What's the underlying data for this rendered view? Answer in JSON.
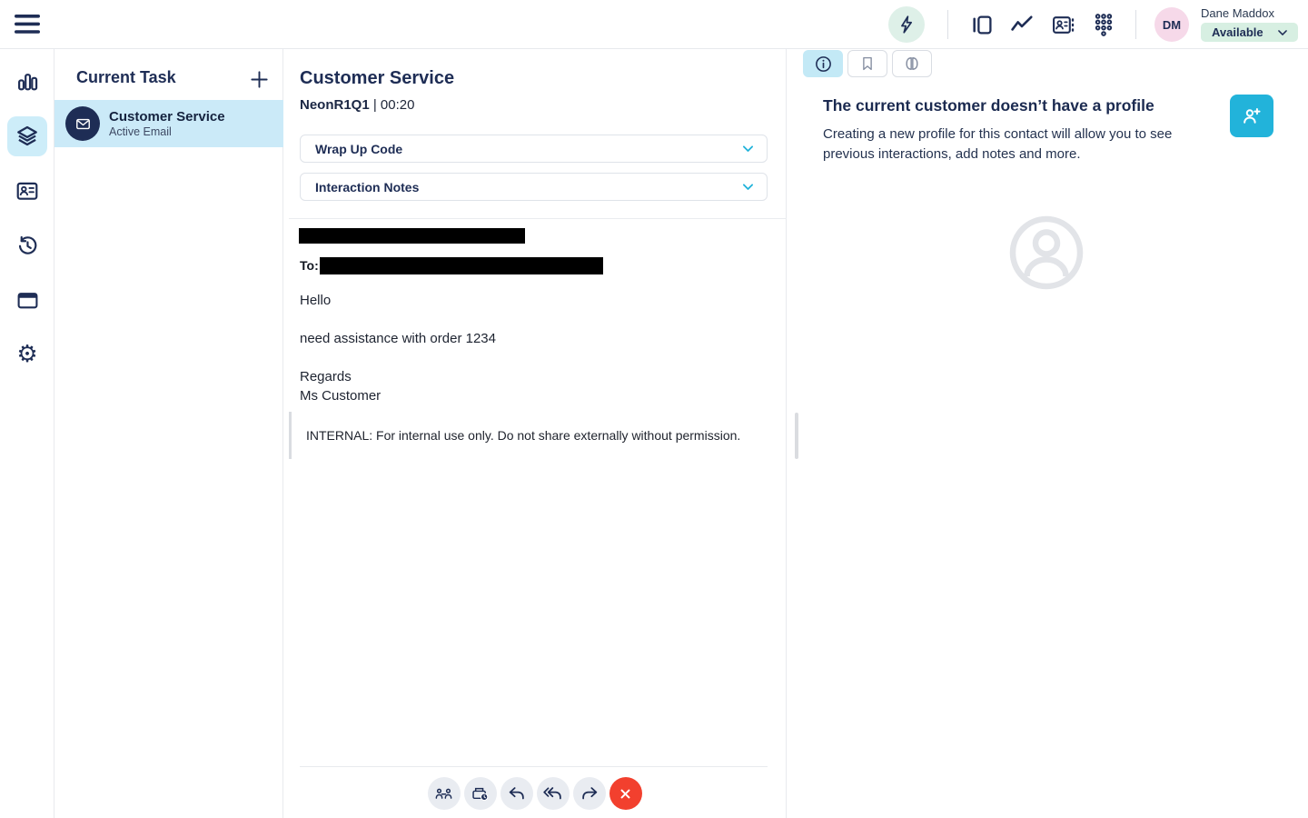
{
  "topbar": {
    "user_name": "Dane Maddox",
    "avatar_initials": "DM",
    "status_label": "Available"
  },
  "task_panel": {
    "title": "Current Task",
    "items": [
      {
        "title": "Customer Service",
        "subtitle": "Active Email"
      }
    ]
  },
  "main": {
    "title": "Customer Service",
    "interaction_id": "NeonR1Q1",
    "separator": " | ",
    "duration": "00:20",
    "accordions": [
      {
        "label": "Wrap Up Code"
      },
      {
        "label": "Interaction Notes"
      }
    ],
    "email": {
      "to_label": "To:",
      "greeting": "Hello",
      "body": "need assistance with order 1234",
      "signoff": "Regards",
      "sender": "Ms Customer",
      "internal_note": "INTERNAL: For internal use only. Do not share externally without permission."
    }
  },
  "right_panel": {
    "no_profile_title": "The current customer doesn’t have a profile",
    "no_profile_body": "Creating a new profile for this contact will allow you to see previous interactions, add notes and more."
  },
  "icons": {
    "topbar": [
      "menu",
      "lightning",
      "panels",
      "line-chart",
      "contact-card",
      "dialpad",
      "chevron-down"
    ],
    "nav_rail": [
      "bar-chart",
      "layers",
      "contact-card",
      "history",
      "browser-window",
      "gear"
    ],
    "task": [
      "plus",
      "envelope"
    ],
    "accordion": [
      "chevron-down"
    ],
    "toolbar": [
      "transfer-people",
      "park-email",
      "reply",
      "reply-all",
      "forward",
      "close"
    ],
    "right_tabs": [
      "info",
      "bookmark",
      "brain"
    ],
    "right_panel": [
      "person-plus",
      "profile-placeholder"
    ]
  },
  "colors": {
    "navy": "#1e2d55",
    "accent_teal": "#22b3da",
    "highlight_blue": "#cbeaf8",
    "status_green_bg": "#d7efe2",
    "lightning_green_bg": "#def0e8",
    "avatar_pink_bg": "#f6d9e9",
    "danger_red": "#f2402e",
    "toolbar_circle_gray": "#e9ecf1"
  }
}
